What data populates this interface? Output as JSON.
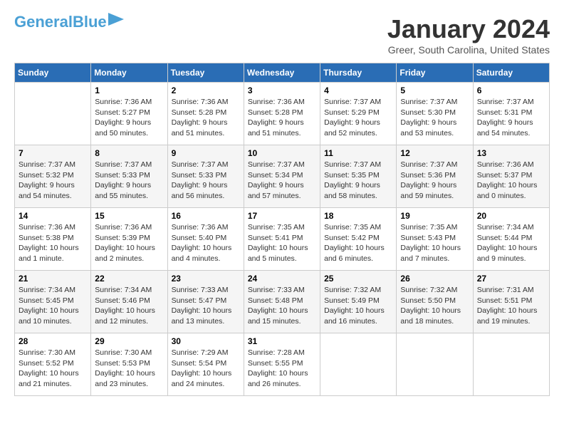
{
  "logo": {
    "line1": "General",
    "line2": "Blue",
    "arrow": "▶"
  },
  "title": "January 2024",
  "location": "Greer, South Carolina, United States",
  "days_of_week": [
    "Sunday",
    "Monday",
    "Tuesday",
    "Wednesday",
    "Thursday",
    "Friday",
    "Saturday"
  ],
  "weeks": [
    [
      {
        "num": "",
        "info": ""
      },
      {
        "num": "1",
        "info": "Sunrise: 7:36 AM\nSunset: 5:27 PM\nDaylight: 9 hours\nand 50 minutes."
      },
      {
        "num": "2",
        "info": "Sunrise: 7:36 AM\nSunset: 5:28 PM\nDaylight: 9 hours\nand 51 minutes."
      },
      {
        "num": "3",
        "info": "Sunrise: 7:36 AM\nSunset: 5:28 PM\nDaylight: 9 hours\nand 51 minutes."
      },
      {
        "num": "4",
        "info": "Sunrise: 7:37 AM\nSunset: 5:29 PM\nDaylight: 9 hours\nand 52 minutes."
      },
      {
        "num": "5",
        "info": "Sunrise: 7:37 AM\nSunset: 5:30 PM\nDaylight: 9 hours\nand 53 minutes."
      },
      {
        "num": "6",
        "info": "Sunrise: 7:37 AM\nSunset: 5:31 PM\nDaylight: 9 hours\nand 54 minutes."
      }
    ],
    [
      {
        "num": "7",
        "info": "Sunrise: 7:37 AM\nSunset: 5:32 PM\nDaylight: 9 hours\nand 54 minutes."
      },
      {
        "num": "8",
        "info": "Sunrise: 7:37 AM\nSunset: 5:33 PM\nDaylight: 9 hours\nand 55 minutes."
      },
      {
        "num": "9",
        "info": "Sunrise: 7:37 AM\nSunset: 5:33 PM\nDaylight: 9 hours\nand 56 minutes."
      },
      {
        "num": "10",
        "info": "Sunrise: 7:37 AM\nSunset: 5:34 PM\nDaylight: 9 hours\nand 57 minutes."
      },
      {
        "num": "11",
        "info": "Sunrise: 7:37 AM\nSunset: 5:35 PM\nDaylight: 9 hours\nand 58 minutes."
      },
      {
        "num": "12",
        "info": "Sunrise: 7:37 AM\nSunset: 5:36 PM\nDaylight: 9 hours\nand 59 minutes."
      },
      {
        "num": "13",
        "info": "Sunrise: 7:36 AM\nSunset: 5:37 PM\nDaylight: 10 hours\nand 0 minutes."
      }
    ],
    [
      {
        "num": "14",
        "info": "Sunrise: 7:36 AM\nSunset: 5:38 PM\nDaylight: 10 hours\nand 1 minute."
      },
      {
        "num": "15",
        "info": "Sunrise: 7:36 AM\nSunset: 5:39 PM\nDaylight: 10 hours\nand 2 minutes."
      },
      {
        "num": "16",
        "info": "Sunrise: 7:36 AM\nSunset: 5:40 PM\nDaylight: 10 hours\nand 4 minutes."
      },
      {
        "num": "17",
        "info": "Sunrise: 7:35 AM\nSunset: 5:41 PM\nDaylight: 10 hours\nand 5 minutes."
      },
      {
        "num": "18",
        "info": "Sunrise: 7:35 AM\nSunset: 5:42 PM\nDaylight: 10 hours\nand 6 minutes."
      },
      {
        "num": "19",
        "info": "Sunrise: 7:35 AM\nSunset: 5:43 PM\nDaylight: 10 hours\nand 7 minutes."
      },
      {
        "num": "20",
        "info": "Sunrise: 7:34 AM\nSunset: 5:44 PM\nDaylight: 10 hours\nand 9 minutes."
      }
    ],
    [
      {
        "num": "21",
        "info": "Sunrise: 7:34 AM\nSunset: 5:45 PM\nDaylight: 10 hours\nand 10 minutes."
      },
      {
        "num": "22",
        "info": "Sunrise: 7:34 AM\nSunset: 5:46 PM\nDaylight: 10 hours\nand 12 minutes."
      },
      {
        "num": "23",
        "info": "Sunrise: 7:33 AM\nSunset: 5:47 PM\nDaylight: 10 hours\nand 13 minutes."
      },
      {
        "num": "24",
        "info": "Sunrise: 7:33 AM\nSunset: 5:48 PM\nDaylight: 10 hours\nand 15 minutes."
      },
      {
        "num": "25",
        "info": "Sunrise: 7:32 AM\nSunset: 5:49 PM\nDaylight: 10 hours\nand 16 minutes."
      },
      {
        "num": "26",
        "info": "Sunrise: 7:32 AM\nSunset: 5:50 PM\nDaylight: 10 hours\nand 18 minutes."
      },
      {
        "num": "27",
        "info": "Sunrise: 7:31 AM\nSunset: 5:51 PM\nDaylight: 10 hours\nand 19 minutes."
      }
    ],
    [
      {
        "num": "28",
        "info": "Sunrise: 7:30 AM\nSunset: 5:52 PM\nDaylight: 10 hours\nand 21 minutes."
      },
      {
        "num": "29",
        "info": "Sunrise: 7:30 AM\nSunset: 5:53 PM\nDaylight: 10 hours\nand 23 minutes."
      },
      {
        "num": "30",
        "info": "Sunrise: 7:29 AM\nSunset: 5:54 PM\nDaylight: 10 hours\nand 24 minutes."
      },
      {
        "num": "31",
        "info": "Sunrise: 7:28 AM\nSunset: 5:55 PM\nDaylight: 10 hours\nand 26 minutes."
      },
      {
        "num": "",
        "info": ""
      },
      {
        "num": "",
        "info": ""
      },
      {
        "num": "",
        "info": ""
      }
    ]
  ]
}
